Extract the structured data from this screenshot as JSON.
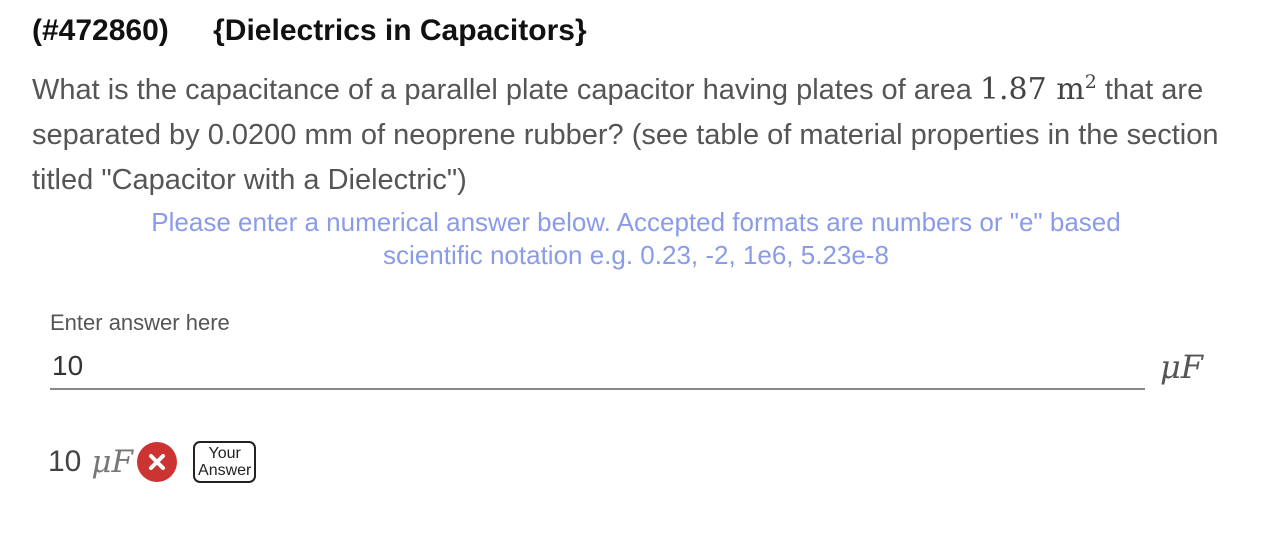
{
  "header": {
    "id": "(#472860)",
    "topic": "{Dielectrics in Capacitors}"
  },
  "question": {
    "text_before": "What is the capacitance of a parallel plate capacitor having plates of area ",
    "area_value": "1.87",
    "area_unit": "m",
    "area_exponent": "2",
    "text_after": " that are separated by 0.0200 mm of neoprene rubber?  (see table of material properties in the section titled \"Capacitor with a Dielectric\")"
  },
  "instructions": "Please enter a numerical answer below. Accepted formats are numbers or \"e\" based scientific notation e.g. 0.23, -2, 1e6, 5.23e-8",
  "answer": {
    "label": "Enter answer here",
    "value": "10",
    "unit": "μF"
  },
  "submission": {
    "value": "10",
    "unit": "μF",
    "status_icon": "x-circle-icon",
    "badge_line1": "Your",
    "badge_line2": "Answer"
  },
  "colors": {
    "instructions": "#8a9be8",
    "wrong": "#cc3333"
  }
}
